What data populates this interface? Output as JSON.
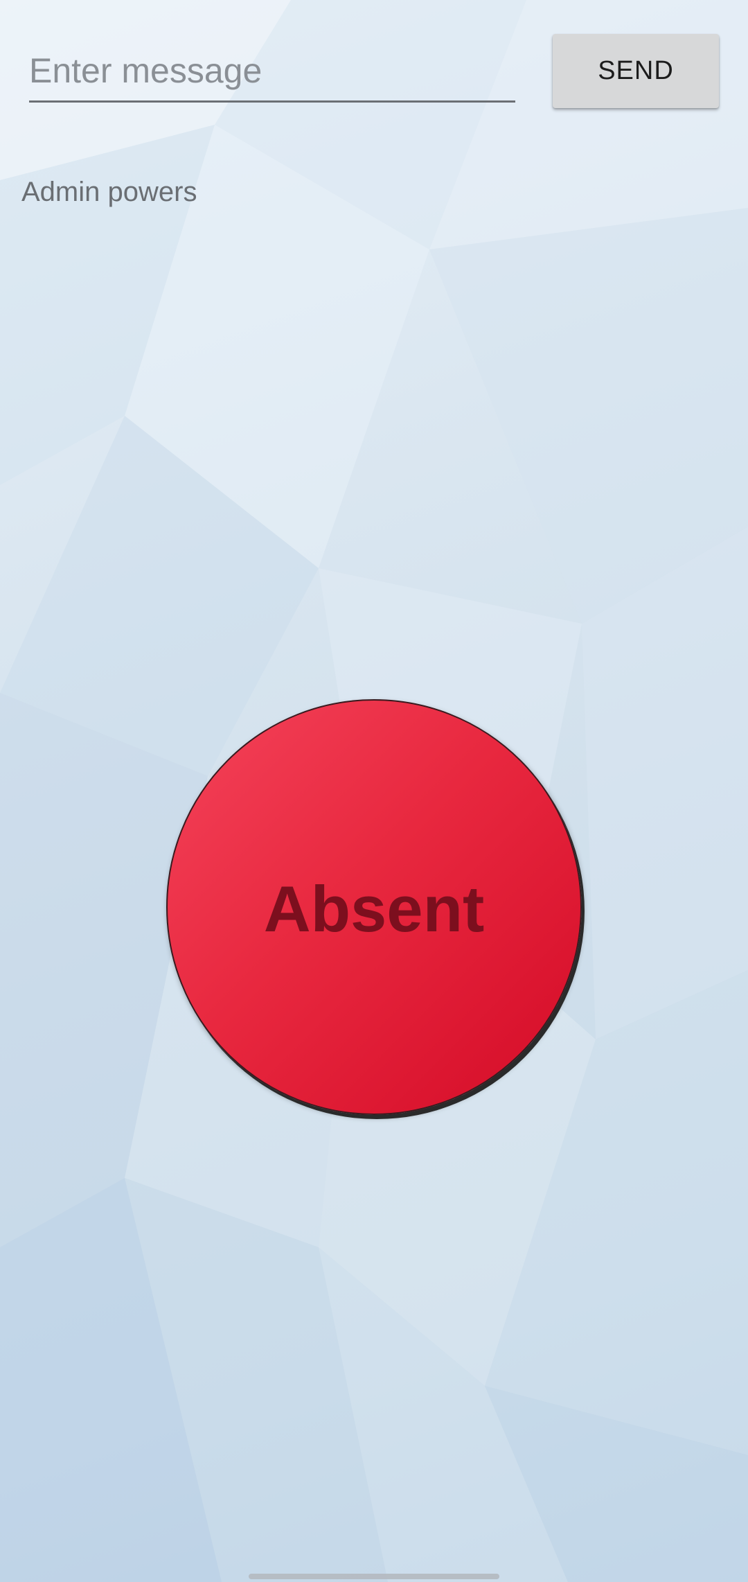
{
  "message": {
    "placeholder": "Enter message",
    "value": ""
  },
  "send_button": {
    "label": "SEND"
  },
  "admin_label": "Admin powers",
  "status_button": {
    "label": "Absent",
    "color": "#e8283f",
    "text_color": "#7c0f1e"
  }
}
